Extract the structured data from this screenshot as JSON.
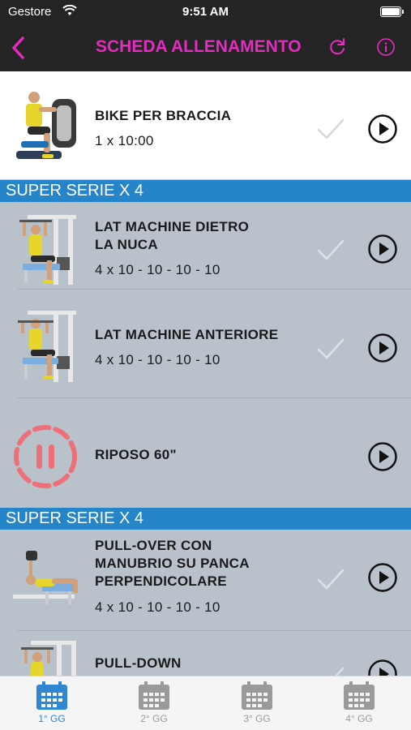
{
  "status": {
    "carrier": "Gestore",
    "time": "9:51 AM"
  },
  "nav": {
    "title": "SCHEDA ALLENAMENTO",
    "accent": "#e42dc0"
  },
  "items": [
    {
      "name_lines": [
        "BIKE PER BRACCIA"
      ],
      "sets": "1 x 10:00"
    },
    {
      "name_lines": [
        "LAT MACHINE DIETRO",
        "LA NUCA"
      ],
      "sets": "4 x 10 - 10 - 10 - 10"
    },
    {
      "name_lines": [
        "LAT MACHINE ANTERIORE"
      ],
      "sets": "4 x 10 - 10 - 10 - 10"
    },
    {
      "name_lines": [
        "RIPOSO 60\""
      ],
      "sets": ""
    },
    {
      "name_lines": [
        "PULL-OVER CON",
        "MANUBRIO SU PANCA",
        "PERPENDICOLARE"
      ],
      "sets": "4 x 10 - 10 - 10 - 10"
    },
    {
      "name_lines": [
        "PULL-DOWN"
      ],
      "sets": ""
    }
  ],
  "supersets": [
    "SUPER SERIE X 4",
    "SUPER SERIE X 4"
  ],
  "tabs": [
    {
      "label": "1° GG",
      "active": true
    },
    {
      "label": "2° GG",
      "active": false
    },
    {
      "label": "3° GG",
      "active": false
    },
    {
      "label": "4° GG",
      "active": false
    }
  ],
  "colors": {
    "superset_bar": "#2684c9",
    "tab_active": "#2f86d3",
    "rest_icon": "#ef6f78"
  }
}
